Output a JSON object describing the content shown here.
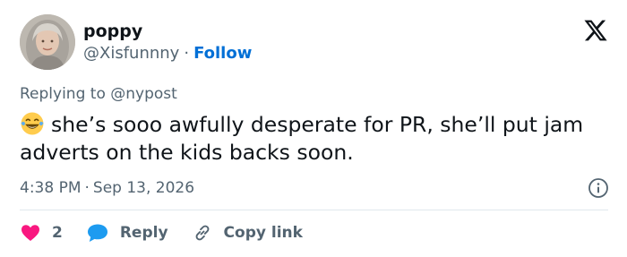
{
  "author": {
    "name": "poppy",
    "handle": "@Xisfunnny",
    "separator": "·",
    "follow_label": "Follow"
  },
  "reply_context": {
    "prefix": "Replying to",
    "mention": "@nypost"
  },
  "tweet": {
    "emoji": "face-with-tears-of-joy",
    "text": "she’s sooo awfully desperate for PR, she’ll put jam adverts on the kids backs soon."
  },
  "meta": {
    "time": "4:38 PM",
    "separator": "·",
    "date": "Sep 13, 2026"
  },
  "actions": {
    "like_count": "2",
    "reply_label": "Reply",
    "copy_link_label": "Copy link"
  },
  "icons": {
    "brand": "x-logo-icon",
    "info": "info-icon",
    "like": "heart-icon",
    "reply": "speech-bubble-icon",
    "copy": "link-icon"
  },
  "colors": {
    "text_primary": "#0f1419",
    "text_secondary": "#536471",
    "follow_blue": "#006fd6",
    "like_pink": "#f91880",
    "reply_blue": "#1d9bf0",
    "divider": "#e1e8ed"
  }
}
